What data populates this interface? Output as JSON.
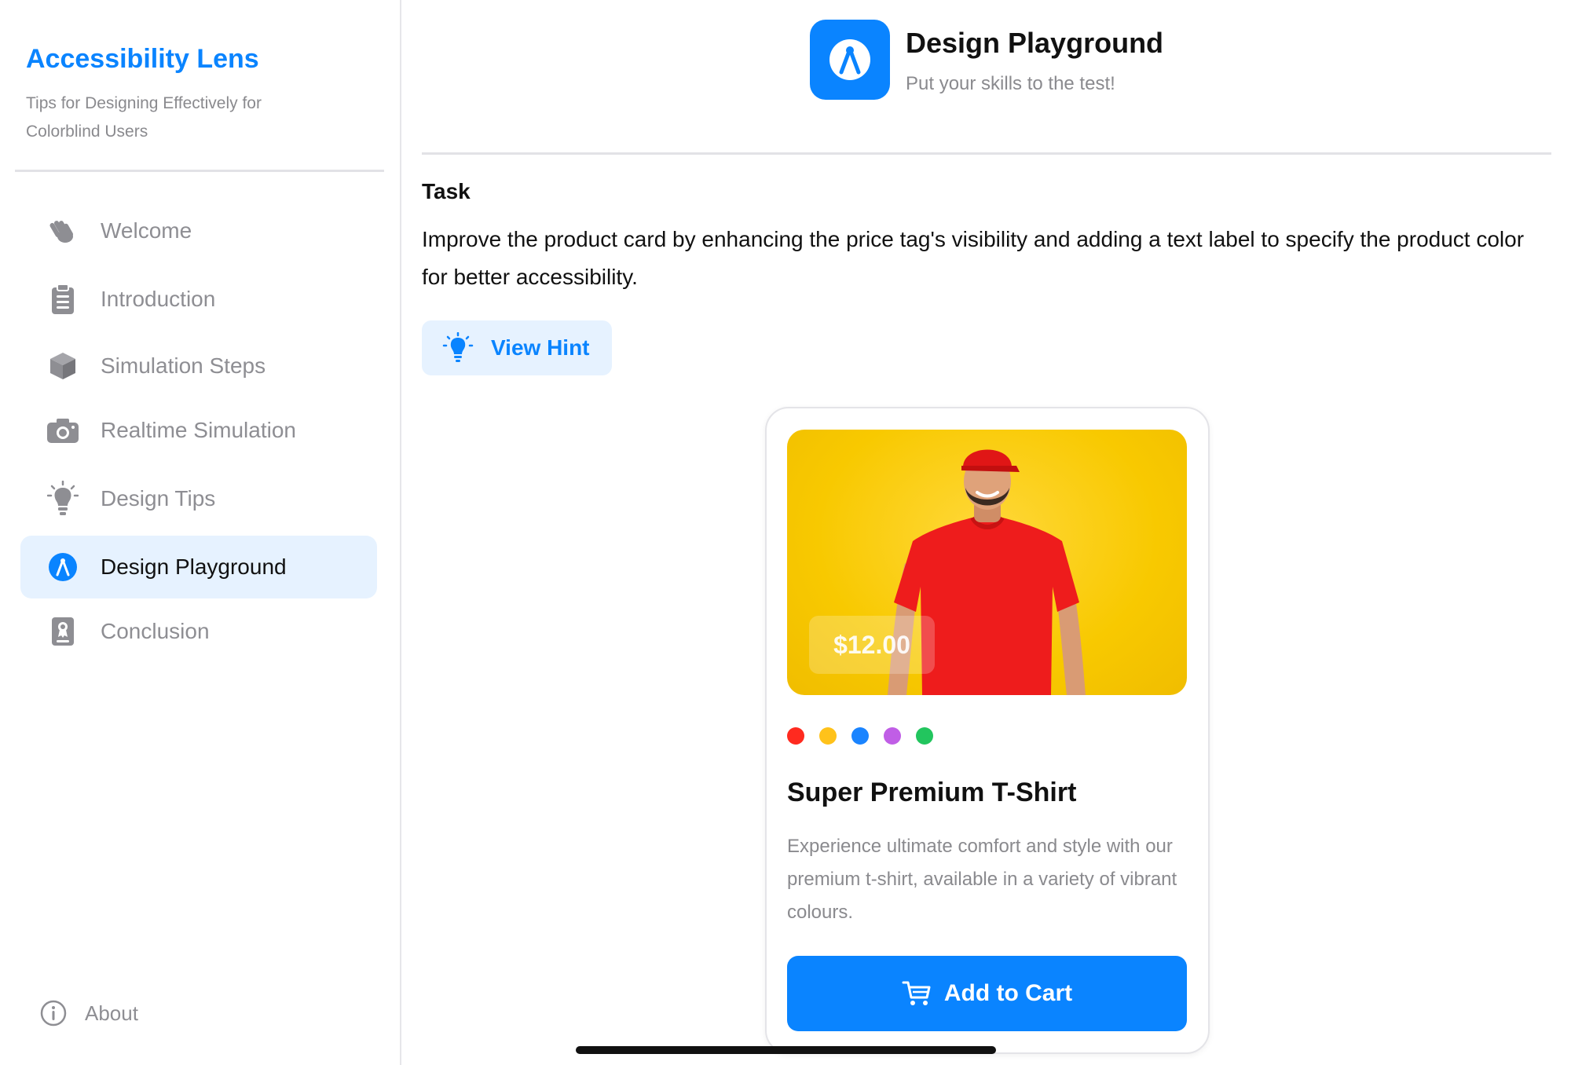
{
  "sidebar": {
    "app_title": "Accessibility Lens",
    "app_subtitle": "Tips for Designing Effectively for Colorblind Users",
    "items": [
      {
        "label": "Welcome",
        "icon": "hand-wave-icon",
        "active": false
      },
      {
        "label": "Introduction",
        "icon": "clipboard-icon",
        "active": false
      },
      {
        "label": "Simulation Steps",
        "icon": "cube-icon",
        "active": false
      },
      {
        "label": "Realtime Simulation",
        "icon": "camera-icon",
        "active": false
      },
      {
        "label": "Design Tips",
        "icon": "lightbulb-icon",
        "active": false
      },
      {
        "label": "Design Playground",
        "icon": "compass-icon",
        "active": true
      },
      {
        "label": "Conclusion",
        "icon": "certificate-icon",
        "active": false
      }
    ],
    "about_label": "About"
  },
  "header": {
    "title": "Design Playground",
    "subtitle": "Put your skills to the test!",
    "icon": "compass-icon"
  },
  "task": {
    "heading": "Task",
    "body": "Improve the product card by enhancing the price tag's visibility and adding a text label to specify the product color for better accessibility.",
    "hint_label": "View Hint"
  },
  "product_card": {
    "price": "$12.00",
    "swatch_colors": [
      "#ff2a1f",
      "#ffc21a",
      "#1a84ff",
      "#c05ee6",
      "#22c55e"
    ],
    "title": "Super Premium T-Shirt",
    "description": "Experience ultimate comfort and style with our premium t-shirt, available in a variety of vibrant colours.",
    "button_label": "Add to Cart"
  },
  "colors": {
    "accent": "#0a84ff",
    "active_row_bg": "#e6f2ff",
    "product_bg": "#f8c900",
    "shirt": "#ee1c1c"
  }
}
